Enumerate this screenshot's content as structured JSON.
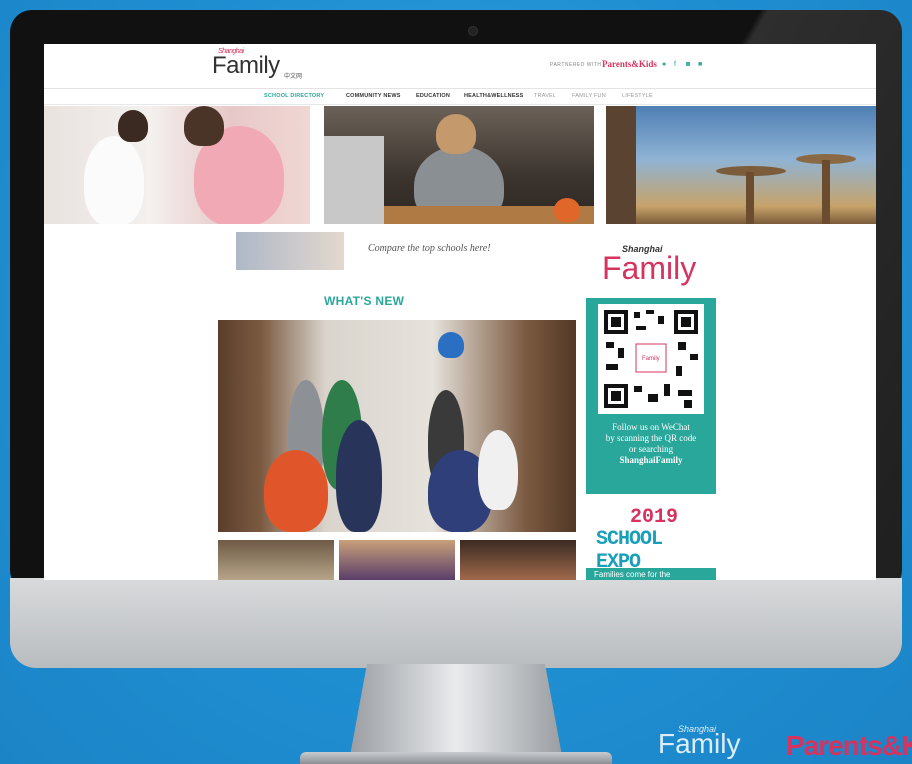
{
  "header": {
    "logo_small": "Shanghai",
    "logo": "Family",
    "logo_cn": "中文网",
    "partner_label": "PARTNERED WITH",
    "partner_logo": "Parents&Kids",
    "social_icons": [
      "wechat-icon",
      "facebook-icon",
      "instagram-icon",
      "video-icon"
    ]
  },
  "nav": {
    "items": [
      {
        "label": "SCHOOL DIRECTORY",
        "active": true
      },
      {
        "label": "COMMUNITY NEWS"
      },
      {
        "label": "EDUCATION"
      },
      {
        "label": "HEALTH&WELLNESS"
      },
      {
        "label": "TRAVEL"
      },
      {
        "label": "FAMILY FUN"
      },
      {
        "label": "LIFESTYLE"
      }
    ]
  },
  "banner": {
    "text": "Compare the top schools here!"
  },
  "section": {
    "title": "WHAT'S NEW"
  },
  "sidebar": {
    "logo_small": "Shanghai",
    "logo": "Family",
    "qr_label": "Family",
    "follow_lines": [
      "Follow us on WeChat",
      "by scanning the QR code",
      "or searching"
    ],
    "follow_handle": "ShanghaiFamily",
    "expo_year": "2019",
    "expo_title": "SCHOOL EXPO",
    "expo_caption": "Families come for the"
  },
  "footer_logos": {
    "family_small": "Shanghai",
    "family": "Family",
    "parents": "Parents&K"
  },
  "colors": {
    "accent_teal": "#2aa79b",
    "brand_pink": "#d6335f",
    "background_blue": "#2196d8"
  }
}
